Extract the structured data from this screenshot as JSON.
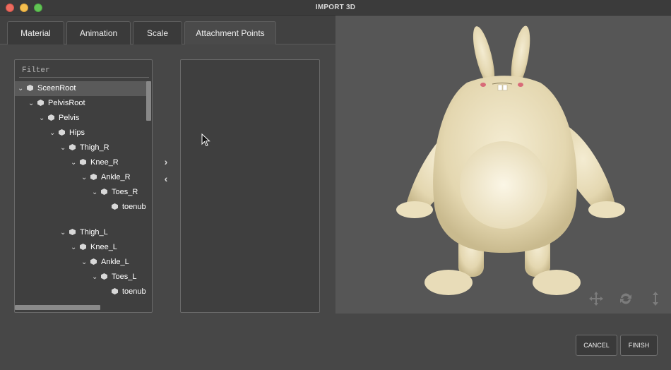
{
  "window": {
    "title": "IMPORT 3D"
  },
  "tabs": [
    {
      "label": "Material"
    },
    {
      "label": "Animation"
    },
    {
      "label": "Scale"
    },
    {
      "label": "Attachment Points"
    }
  ],
  "filter": {
    "placeholder": "Filter",
    "value": ""
  },
  "tree": [
    {
      "label": "SceenRoot",
      "depth": 0,
      "expanded": true,
      "selected": true
    },
    {
      "label": "PelvisRoot",
      "depth": 1,
      "expanded": true
    },
    {
      "label": "Pelvis",
      "depth": 2,
      "expanded": true
    },
    {
      "label": "Hips",
      "depth": 3,
      "expanded": true
    },
    {
      "label": "Thigh_R",
      "depth": 4,
      "expanded": true
    },
    {
      "label": "Knee_R",
      "depth": 5,
      "expanded": true
    },
    {
      "label": "Ankle_R",
      "depth": 6,
      "expanded": true
    },
    {
      "label": "Toes_R",
      "depth": 7,
      "expanded": true
    },
    {
      "label": "toenub",
      "depth": 8,
      "expanded": false
    },
    {
      "label": "Thigh_L",
      "depth": 4,
      "expanded": true
    },
    {
      "label": "Knee_L",
      "depth": 5,
      "expanded": true
    },
    {
      "label": "Ankle_L",
      "depth": 6,
      "expanded": true
    },
    {
      "label": "Toes_L",
      "depth": 7,
      "expanded": true
    },
    {
      "label": "toenub",
      "depth": 8,
      "expanded": false
    }
  ],
  "transfer": {
    "add_icon": "chevron-right-icon",
    "remove_icon": "chevron-left-icon"
  },
  "viewport": {
    "icons": [
      "move-icon",
      "rotate-icon",
      "vertical-resize-icon"
    ]
  },
  "footer": {
    "cancel_label": "CANCEL",
    "finish_label": "FINISH"
  },
  "colors": {
    "background": "#474747",
    "viewport": "#565656",
    "panel": "#3f3f3f",
    "selection": "#5a5a5a"
  }
}
